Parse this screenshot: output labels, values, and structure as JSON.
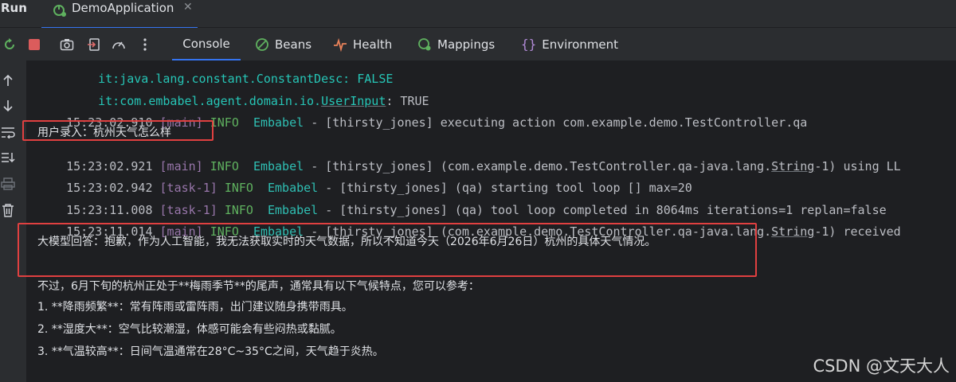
{
  "run_bar": {
    "label": "Run",
    "tab_label": "DemoApplication",
    "tab_close": "✕"
  },
  "toolbar": {
    "tabs": [
      {
        "label": "Console",
        "active": true
      },
      {
        "label": "Beans"
      },
      {
        "label": "Health"
      },
      {
        "label": "Mappings"
      },
      {
        "label": "Environment"
      }
    ]
  },
  "console": {
    "lines": [
      {
        "kind": "prop",
        "text": "it:java.lang.constant.ConstantDesc: FALSE"
      },
      {
        "kind": "prop",
        "key": "it:com.embabel.agent.domain.io.",
        "key_ul": "UserInput",
        "val": ": TRUE"
      },
      {
        "kind": "log",
        "ts": "15:23:02.910",
        "thread": "[main]",
        "level": "INFO",
        "logger": "Embabel",
        "msg": "- [thirsty_jones] executing action com.example.demo.TestController.qa"
      },
      {
        "kind": "cn",
        "text": "用户录入：杭州天气怎么样"
      },
      {
        "kind": "log",
        "ts": "15:23:02.921",
        "thread": "[main]",
        "level": "INFO",
        "logger": "Embabel",
        "msg_a": "- [thirsty_jones] (com.example.demo.TestController.qa-java.lang.",
        "msg_ul": "String",
        "msg_b": "-1) using LL"
      },
      {
        "kind": "log",
        "ts": "15:23:02.942",
        "thread": "[task-1]",
        "level": "INFO",
        "logger": "Embabel",
        "msg": "- [thirsty_jones] (qa) starting tool loop [] max=20"
      },
      {
        "kind": "log",
        "ts": "15:23:11.008",
        "thread": "[task-1]",
        "level": "INFO",
        "logger": "Embabel",
        "msg": "- [thirsty_jones] (qa) tool loop completed in 8064ms iterations=1 replan=false"
      },
      {
        "kind": "log",
        "ts": "15:23:11.014",
        "thread": "[main]",
        "level": "INFO",
        "logger": "Embabel",
        "msg_a": "- [thirsty_jones] (com.example.demo.TestController.qa-java.lang.",
        "msg_ul": "String",
        "msg_b": "-1) received"
      },
      {
        "kind": "cn",
        "text": "大模型回答：抱歉，作为人工智能，我无法获取实时的天气数据，所以不知道今天（2026年6月26日）杭州的具体天气情况。"
      },
      {
        "kind": "cn",
        "text": "不过，6月下旬的杭州正处于**梅雨季节**的尾声，通常具有以下气候特点，您可以参考："
      },
      {
        "kind": "cn",
        "text": "1. **降雨频繁**：常有阵雨或雷阵雨，出门建议随身携带雨具。"
      },
      {
        "kind": "cn",
        "text": "2. **湿度大**：空气比较潮湿，体感可能会有些闷热或黏腻。"
      },
      {
        "kind": "cn",
        "text": "3. **气温较高**：日间气温通常在28°C~35°C之间，天气趋于炎热。"
      }
    ]
  },
  "watermark": "CSDN @文天大人",
  "colors": {
    "accent": "#3574f0",
    "highlight_box": "#e04040",
    "log_level": "#5fb15f",
    "thread": "#9876aa",
    "logger": "#2fbfb3"
  }
}
